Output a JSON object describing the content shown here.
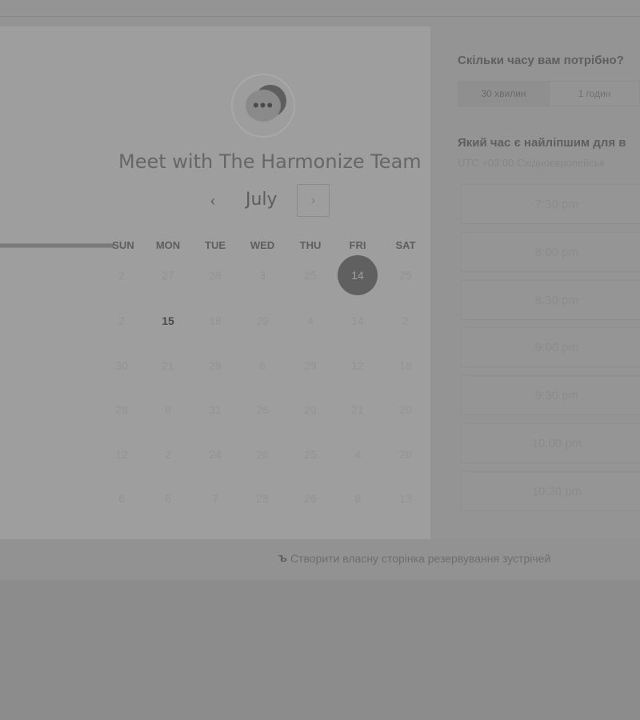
{
  "calendar": {
    "title": "Meet with The Harmonize Team",
    "month": "July",
    "prev_icon": "‹",
    "next_icon": "›",
    "weekdays": [
      "SUN",
      "MON",
      "TUE",
      "WED",
      "THU",
      "FRI",
      "SAT"
    ],
    "weeks": [
      [
        {
          "t": "2"
        },
        {
          "t": "27"
        },
        {
          "t": "28"
        },
        {
          "t": "3"
        },
        {
          "t": "25"
        },
        {
          "t": "14",
          "state": "selected"
        },
        {
          "t": "25"
        }
      ],
      [
        {
          "t": "2"
        },
        {
          "t": "15",
          "state": "active"
        },
        {
          "t": "18"
        },
        {
          "t": "29"
        },
        {
          "t": "4"
        },
        {
          "t": "14"
        },
        {
          "t": "2"
        }
      ],
      [
        {
          "t": "30"
        },
        {
          "t": "21"
        },
        {
          "t": "28"
        },
        {
          "t": "6"
        },
        {
          "t": "29"
        },
        {
          "t": "12"
        },
        {
          "t": "18"
        }
      ],
      [
        {
          "t": "28"
        },
        {
          "t": "8"
        },
        {
          "t": "31"
        },
        {
          "t": "26"
        },
        {
          "t": "20"
        },
        {
          "t": "21"
        },
        {
          "t": "20"
        }
      ],
      [
        {
          "t": "12"
        },
        {
          "t": "2"
        },
        {
          "t": "24"
        },
        {
          "t": "26"
        },
        {
          "t": "25"
        },
        {
          "t": "4"
        },
        {
          "t": "20"
        }
      ],
      [
        {
          "t": "6"
        },
        {
          "t": "6"
        },
        {
          "t": "7"
        },
        {
          "t": "28"
        },
        {
          "t": "26"
        },
        {
          "t": "8"
        },
        {
          "t": "13"
        }
      ]
    ],
    "avatar_icon": "chat-bubbles-icon",
    "avatar_glyph": "•••"
  },
  "booking": {
    "duration_question": "Скільки часу вам потрібно?",
    "durations": [
      {
        "label": "30 хвилин",
        "selected": true
      },
      {
        "label": "1 годин",
        "selected": false
      }
    ],
    "time_question": "Який час є найліпшим для в",
    "timezone": "UTC +03:00 Східноєвропейськ",
    "slots": [
      "7:30 pm",
      "8:00 pm",
      "8:30 pm",
      "9:00 pm",
      "9:30 pm",
      "10:00 pm",
      "10:30 pm"
    ]
  },
  "footer": {
    "link_text": "Створити власну сторінка резервування зустрічей",
    "icon": "hubspot-sprocket-icon",
    "icon_glyph": "ъ"
  },
  "colors": {
    "overlay_bg": "#8c8c8c",
    "card_bg": "#9e9e9e",
    "selected_day": "#606060"
  }
}
